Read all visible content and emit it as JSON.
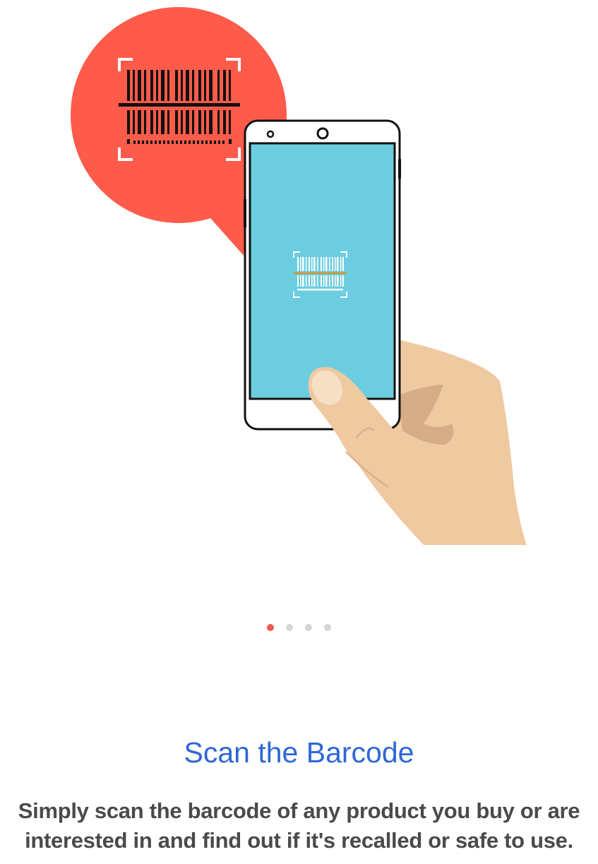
{
  "onboarding": {
    "title": "Scan the Barcode",
    "description_line1": "Simply scan the barcode of any product you buy or are",
    "description_line2": "interested in and find out if it's recalled or safe to use.",
    "page_count": 4,
    "active_page": 1
  },
  "colors": {
    "title": "#2e67d6",
    "description": "#4a4a4a",
    "bubble": "#fe5b4b",
    "screen": "#6ccde0",
    "skin": "#efc9a0",
    "dot_active": "#f0584c",
    "dot_inactive": "#d5d5d5"
  },
  "icons": {
    "bubble_icon": "barcode-scan-icon",
    "screen_icon": "barcode-scan-icon"
  }
}
